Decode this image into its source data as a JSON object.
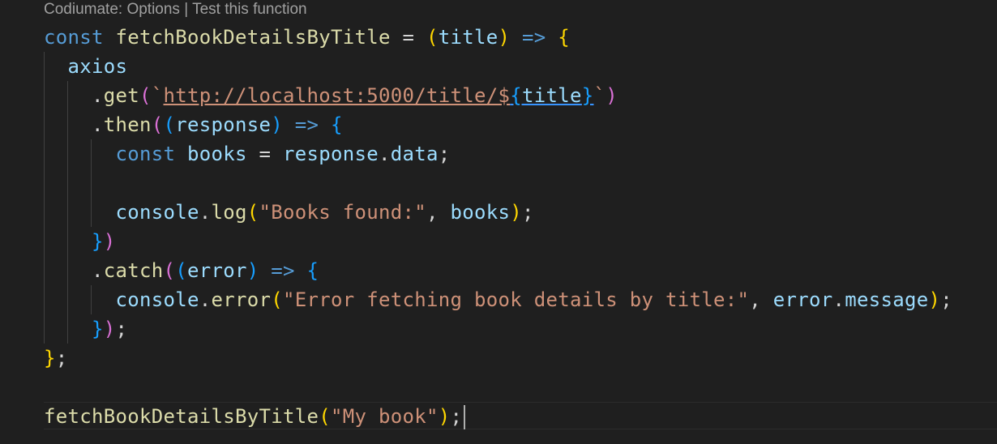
{
  "codelens": {
    "prefix": "Codiumate:",
    "options": "Options",
    "separator": "|",
    "test": "Test this function"
  },
  "code": {
    "l1": {
      "const": "const",
      "name": "fetchBookDetailsByTitle",
      "eq": " = ",
      "open": "(",
      "param": "title",
      "close": ")",
      "arrow": " => ",
      "brace": "{"
    },
    "l2": {
      "obj": "axios"
    },
    "l3": {
      "dot": ".",
      "method": "get",
      "open": "(",
      "tick": "`",
      "url": "http://localhost:5000/title/",
      "dollar": "$",
      "expr_open": "{",
      "expr": "title",
      "expr_close": "}",
      "tick2": "`",
      "close": ")"
    },
    "l4": {
      "dot": ".",
      "method": "then",
      "open": "(",
      "popen": "(",
      "param": "response",
      "pclose": ")",
      "arrow": " => ",
      "brace": "{"
    },
    "l5": {
      "const": "const",
      "name": "books",
      "eq": " = ",
      "obj": "response",
      "dot": ".",
      "prop": "data",
      "semi": ";"
    },
    "l6": {
      "obj": "console",
      "dot": ".",
      "method": "log",
      "open": "(",
      "str": "\"Books found:\"",
      "comma": ", ",
      "arg": "books",
      "close": ")",
      "semi": ";"
    },
    "l7": {
      "brace": "}",
      "close": ")"
    },
    "l8": {
      "dot": ".",
      "method": "catch",
      "open": "(",
      "popen": "(",
      "param": "error",
      "pclose": ")",
      "arrow": " => ",
      "brace": "{"
    },
    "l9": {
      "obj": "console",
      "dot": ".",
      "method": "error",
      "open": "(",
      "str": "\"Error fetching book details by title:\"",
      "comma": ", ",
      "arg": "error",
      "dot2": ".",
      "prop": "message",
      "close": ")",
      "semi": ";"
    },
    "l10": {
      "brace": "}",
      "close": ")",
      "semi": ";"
    },
    "l11": {
      "brace": "}",
      "semi": ";"
    },
    "l12": {
      "fn": "fetchBookDetailsByTitle",
      "open": "(",
      "str": "\"My book\"",
      "close": ")",
      "semi": ";"
    }
  }
}
